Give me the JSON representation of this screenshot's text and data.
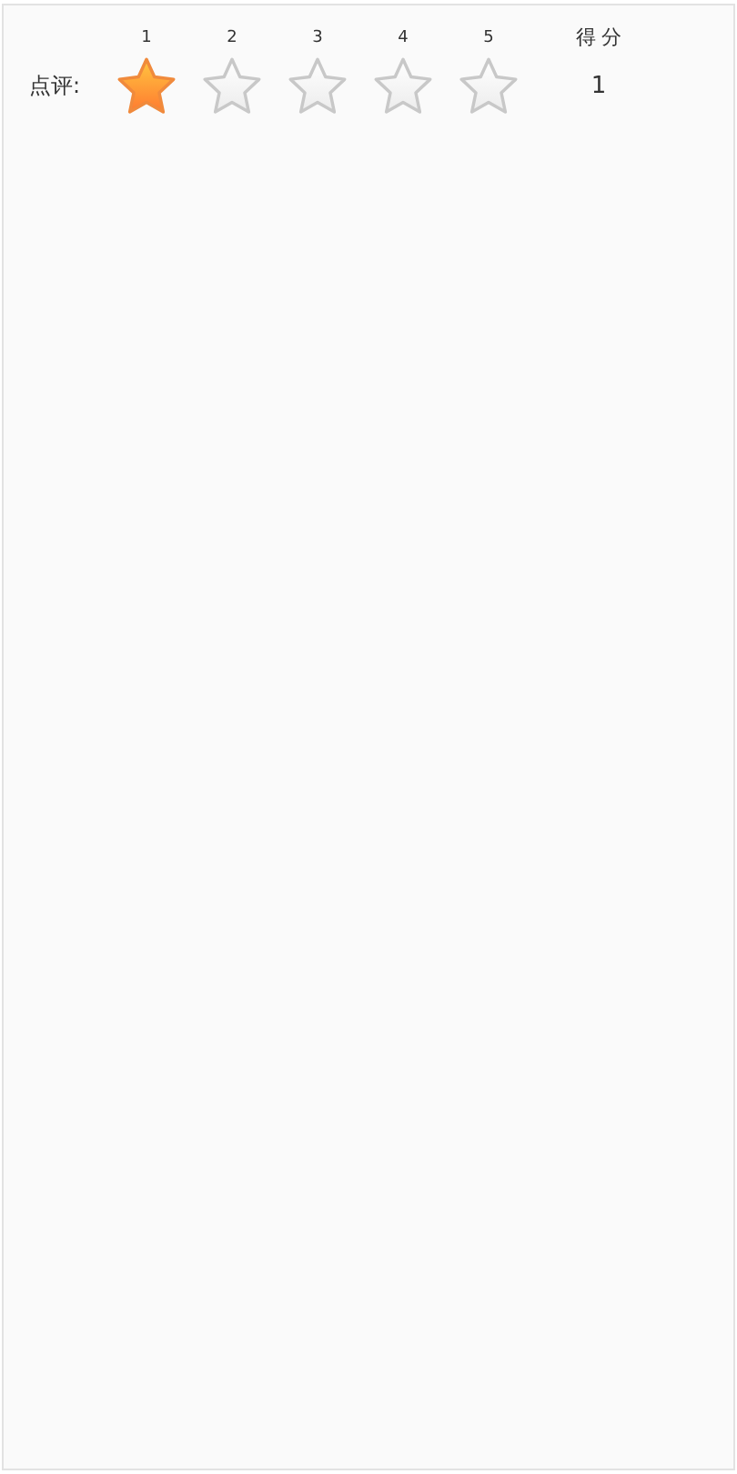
{
  "rating": {
    "label": "点评:",
    "scale": [
      "1",
      "2",
      "3",
      "4",
      "5"
    ],
    "stars": 1
  },
  "score": {
    "heading": "得 分",
    "value": "1"
  }
}
